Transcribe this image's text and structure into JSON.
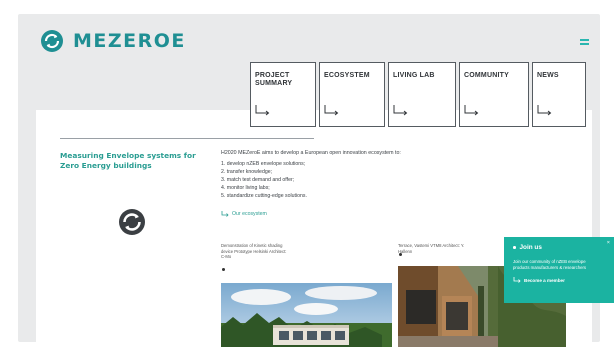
{
  "brand": {
    "name": "MEZEROE"
  },
  "nav": {
    "items": [
      {
        "label": "PROJECT SUMMARY"
      },
      {
        "label": "ECOSYSTEM"
      },
      {
        "label": "LIVING LAB"
      },
      {
        "label": "COMMUNITY"
      },
      {
        "label": "NEWS"
      }
    ]
  },
  "side": {
    "title": "Measuring Envelope systems for Zero Energy buildings"
  },
  "content": {
    "intro": "H2020 MEZeroE aims to develop a European open innovation ecosystem to:",
    "list": [
      "1. develop nZEB envelope solutions;",
      "2. transfer knowledge;",
      "3. match test demand and offer;",
      "4. monitor living labs;",
      "5. standardize cutting-edge solutions."
    ],
    "link_label": "Our ecosystem"
  },
  "captions": {
    "left": "Demonstration of Kinetic shading device Prototype Helsinki Architect: C-Mo",
    "right": "Terrace, Vastemi VTM8 Architect: Y. Hallenn"
  },
  "join": {
    "title": "Join us",
    "text": "Join our community of nZEB envelope products manufacturers & researchers",
    "link_label": "Become a member",
    "close": "×"
  },
  "colors": {
    "accent": "#1f8f93",
    "teal": "#2a9d92",
    "join_bg": "#1bb3a1",
    "band_bg": "#e9eaeb"
  }
}
